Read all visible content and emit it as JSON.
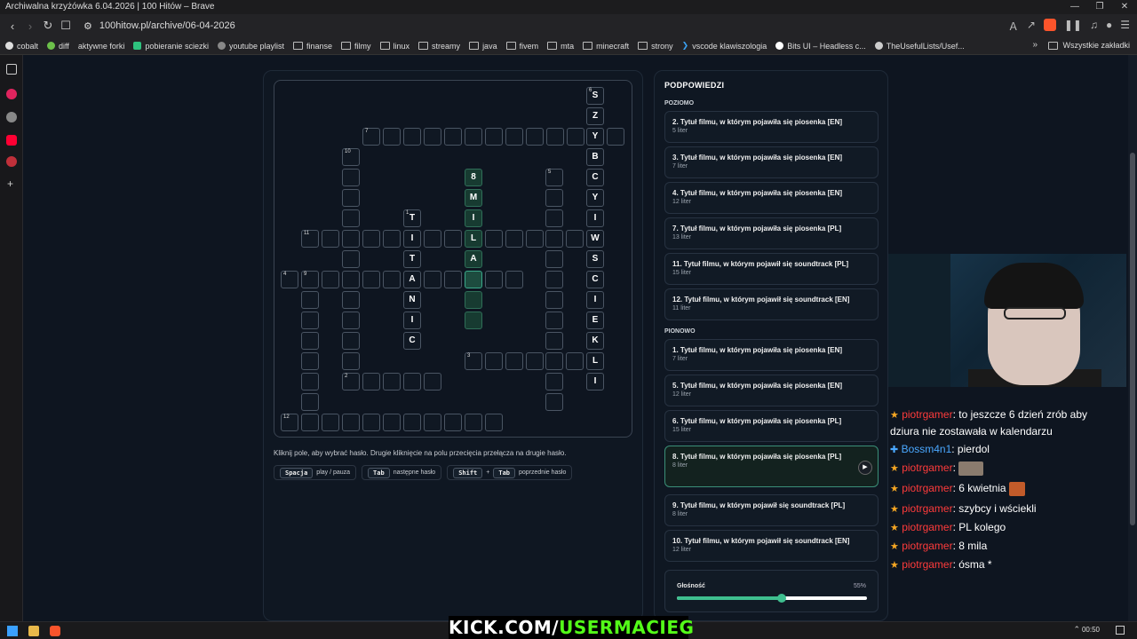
{
  "browser": {
    "window_title": "Archiwalna krzyżówka 6.04.2026 | 100 Hitów – Brave",
    "url": "100hitow.pl/archive/06-04-2026",
    "bookmarks": [
      "cobalt",
      "diff",
      "aktywne forki",
      "pobieranie sciezki",
      "youtube playlist",
      "finanse",
      "filmy",
      "linux",
      "streamy",
      "java",
      "fivem",
      "mta",
      "minecraft",
      "strony",
      "vscode klawiszologia",
      "Bits UI – Headless c...",
      "TheUsefulLists/Usef..."
    ],
    "bookmarks_all": "Wszystkie zakładki"
  },
  "crossword": {
    "numbers": {
      "n1": "1",
      "n2": "2",
      "n3": "3",
      "n4": "4",
      "n5": "5",
      "n6": "6",
      "n7": "7",
      "n8": "8",
      "n9": "9",
      "n10": "10",
      "n11": "11",
      "n12": "12"
    },
    "letters": {
      "s1": "S",
      "s2": "Z",
      "s3": "Y",
      "s4": "B",
      "s5": "C",
      "s6": "Y",
      "s7": "I",
      "s8": "W",
      "s9": "S",
      "s10": "C",
      "s11": "I",
      "s12": "E",
      "s13": "K",
      "s14": "L",
      "s15": "I",
      "t1": "T",
      "t2": "I",
      "t3": "T",
      "t4": "A",
      "t5": "N",
      "t6": "I",
      "t7": "C",
      "m1": "8",
      "m2": "M",
      "m3": "I",
      "m4": "L",
      "m5": "A"
    },
    "help_text": "Kliknij pole, aby wybrać hasło. Drugie kliknięcie na polu przecięcia przełącza na drugie hasło.",
    "keys": {
      "space": "Spacja",
      "space_desc": "play / pauza",
      "tab": "Tab",
      "tab_desc": "następne hasło",
      "shift": "Shift",
      "plus": "+",
      "tab2": "Tab",
      "shift_desc": "poprzednie hasło"
    }
  },
  "hints": {
    "title": "PODPOWIEDZI",
    "across_label": "POZIOMO",
    "down_label": "PIONOWO",
    "across": [
      {
        "title": "2. Tytuł filmu, w którym pojawiła się piosenka [EN]",
        "len": "5 liter"
      },
      {
        "title": "3. Tytuł filmu, w którym pojawiła się piosenka [EN]",
        "len": "7 liter"
      },
      {
        "title": "4. Tytuł filmu, w którym pojawiła się piosenka [EN]",
        "len": "12 liter"
      },
      {
        "title": "7. Tytuł filmu, w którym pojawiła się piosenka [PL]",
        "len": "13 liter"
      },
      {
        "title": "11. Tytuł filmu, w którym pojawił się soundtrack [PL]",
        "len": "15 liter"
      },
      {
        "title": "12. Tytuł filmu, w którym pojawił się soundtrack [EN]",
        "len": "11 liter"
      }
    ],
    "down": [
      {
        "title": "1. Tytuł filmu, w którym pojawiła się piosenka [EN]",
        "len": "7 liter"
      },
      {
        "title": "5. Tytuł filmu, w którym pojawiła się piosenka [EN]",
        "len": "12 liter"
      },
      {
        "title": "6. Tytuł filmu, w którym pojawiła się piosenka [PL]",
        "len": "15 liter"
      },
      {
        "title": "8. Tytuł filmu, w którym pojawiła się piosenka [PL]",
        "len": "8 liter"
      },
      {
        "title": "9. Tytuł filmu, w którym pojawił się soundtrack [PL]",
        "len": "8 liter"
      },
      {
        "title": "10. Tytuł filmu, w którym pojawił się soundtrack [EN]",
        "len": "12 liter"
      }
    ],
    "play_icon": "play-icon",
    "volume_label": "Głośność",
    "volume_value": "55%",
    "volume_fraction": 0.55,
    "accent_color": "#3fbf8f"
  },
  "chat": [
    {
      "nick": "piotrgamer",
      "text": ": to jeszcze 6 dzień zrób aby",
      "text2": "dziura nie zostawała w kalendarzu"
    },
    {
      "nick": "Bossm4n1",
      "text": ": pierdol"
    },
    {
      "nick": "piotrgamer",
      "text": ":"
    },
    {
      "nick": "piotrgamer",
      "text": ": 6 kwietnia"
    },
    {
      "nick": "piotrgamer",
      "text": ": szybcy i wściekli"
    },
    {
      "nick": "piotrgamer",
      "text": ": PL kolego"
    },
    {
      "nick": "piotrgamer",
      "text": ": 8 mila"
    },
    {
      "nick": "piotrgamer",
      "text": ": ósma *"
    }
  ],
  "banner": {
    "left": "KICK.COM/",
    "right": "USERMACIEG"
  },
  "taskbar": {
    "time": "00:50"
  }
}
